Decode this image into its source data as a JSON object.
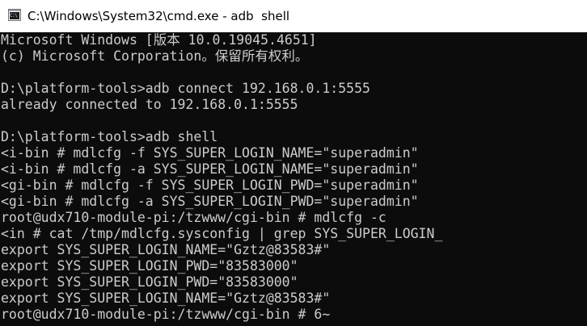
{
  "window": {
    "title": "C:\\Windows\\System32\\cmd.exe - adb  shell",
    "icon": "cmd-icon",
    "icon_text": "C:\\",
    "background": "#0c0c0c",
    "foreground": "#cccccc"
  },
  "console": {
    "lines": [
      "Microsoft Windows [版本 10.0.19045.4651]",
      "(c) Microsoft Corporation。保留所有权利。",
      "",
      "D:\\platform-tools>adb connect 192.168.0.1:5555",
      "already connected to 192.168.0.1:5555",
      "",
      "D:\\platform-tools>adb shell",
      "<i-bin # mdlcfg -f SYS_SUPER_LOGIN_NAME=\"superadmin\"",
      "<i-bin # mdlcfg -a SYS_SUPER_LOGIN_NAME=\"superadmin\"",
      "<gi-bin # mdlcfg -f SYS_SUPER_LOGIN_PWD=\"superadmin\"",
      "<gi-bin # mdlcfg -a SYS_SUPER_LOGIN_PWD=\"superadmin\"",
      "root@udx710-module-pi:/tzwww/cgi-bin # mdlcfg -c",
      "<in # cat /tmp/mdlcfg.sysconfig | grep SYS_SUPER_LOGIN_",
      "export SYS_SUPER_LOGIN_NAME=\"Gztz@83583#\"",
      "export SYS_SUPER_LOGIN_PWD=\"83583000\"",
      "export SYS_SUPER_LOGIN_PWD=\"83583000\"",
      "export SYS_SUPER_LOGIN_NAME=\"Gztz@83583#\"",
      "root@udx710-module-pi:/tzwww/cgi-bin # 6~"
    ]
  }
}
